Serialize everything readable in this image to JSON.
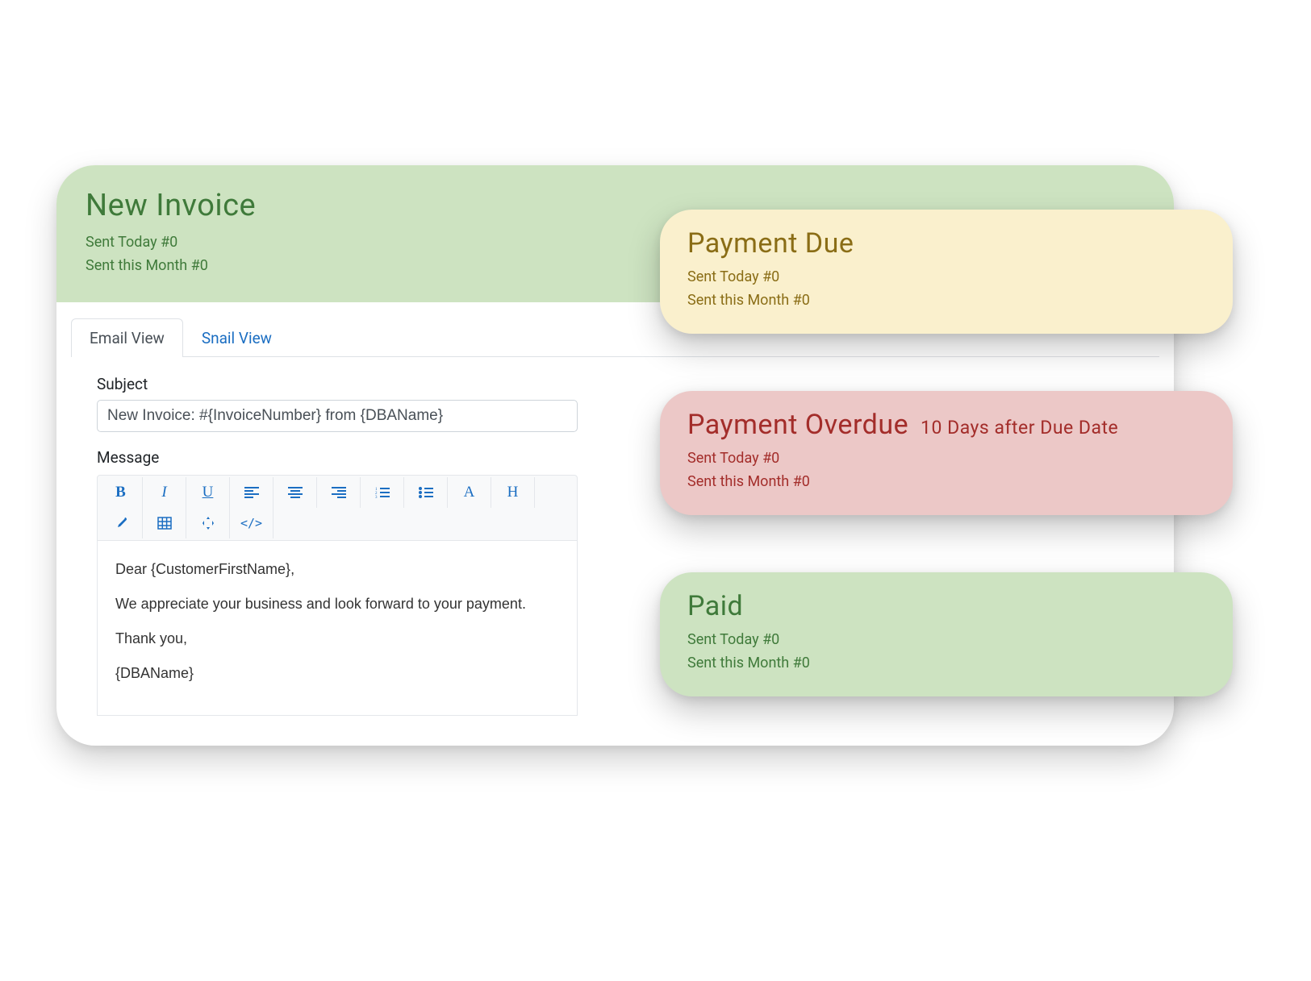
{
  "main": {
    "title": "New Invoice",
    "sent_today": "Sent Today #0",
    "sent_month": "Sent this Month #0",
    "tabs": {
      "email": "Email View",
      "snail": "Snail View"
    },
    "subject_label": "Subject",
    "subject_value": "New Invoice: #{InvoiceNumber} from {DBAName}",
    "message_label": "Message",
    "body": {
      "greeting": "Dear {CustomerFirstName},",
      "line1": "We appreciate your business and look forward to your payment.",
      "thanks": "Thank you,",
      "sig": "{DBAName}"
    }
  },
  "cards": {
    "due": {
      "title": "Payment Due",
      "sent_today": "Sent Today #0",
      "sent_month": "Sent this Month #0"
    },
    "overdue": {
      "title": "Payment Overdue",
      "subtitle": "10 Days after Due Date",
      "sent_today": "Sent Today #0",
      "sent_month": "Sent this Month #0"
    },
    "paid": {
      "title": "Paid",
      "sent_today": "Sent Today #0",
      "sent_month": "Sent this Month #0"
    }
  }
}
